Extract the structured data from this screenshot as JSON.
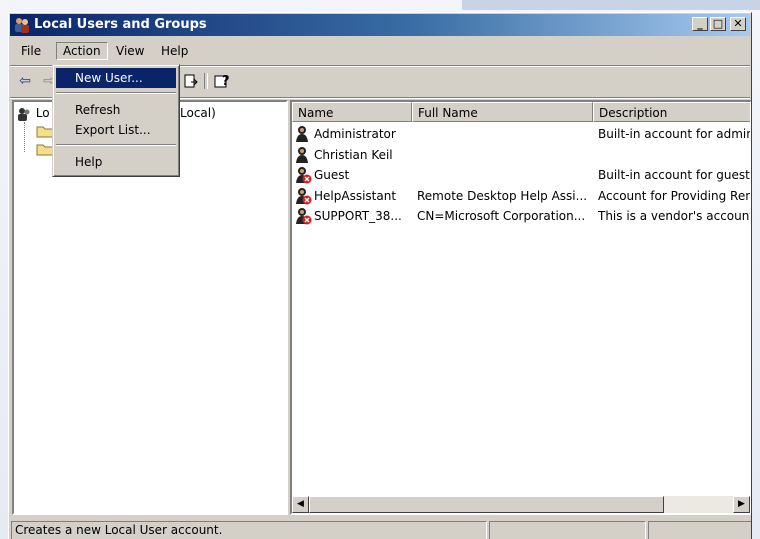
{
  "window": {
    "title": "Local Users and Groups",
    "controls": {
      "minimize": "_",
      "maximize": "□",
      "close": "✕"
    }
  },
  "menubar": {
    "items": [
      "File",
      "Action",
      "View",
      "Help"
    ]
  },
  "toolbar": {
    "icons": [
      "back-arrow-icon",
      "forward-arrow-icon",
      "up-folder-icon",
      "export-icon",
      "help-icon"
    ]
  },
  "tree": {
    "root_prefix": "Lo",
    "root_suffix": "Local)"
  },
  "listview": {
    "columns": [
      "Name",
      "Full Name",
      "Description"
    ],
    "rows": [
      {
        "name": "Administrator",
        "full_name": "",
        "description": "Built-in account for adminis",
        "disabled": false
      },
      {
        "name": "Christian Keil",
        "full_name": "",
        "description": "",
        "disabled": false
      },
      {
        "name": "Guest",
        "full_name": "",
        "description": "Built-in account for guest a",
        "disabled": true
      },
      {
        "name": "HelpAssistant",
        "full_name": "Remote Desktop Help Assi...",
        "description": "Account for Providing Rem",
        "disabled": true
      },
      {
        "name": "SUPPORT_38...",
        "full_name": "CN=Microsoft Corporation...",
        "description": "This is a vendor's account",
        "disabled": true
      }
    ]
  },
  "action_menu": {
    "items": [
      "New User...",
      "Refresh",
      "Export List...",
      "Help"
    ],
    "highlighted": "New User..."
  },
  "statusbar": {
    "text": "Creates a new Local User account."
  },
  "colors": {
    "titlebar_start": "#0a246a",
    "titlebar_end": "#a6caf0",
    "highlight": "#0a246a",
    "face": "#d4d0c8"
  }
}
